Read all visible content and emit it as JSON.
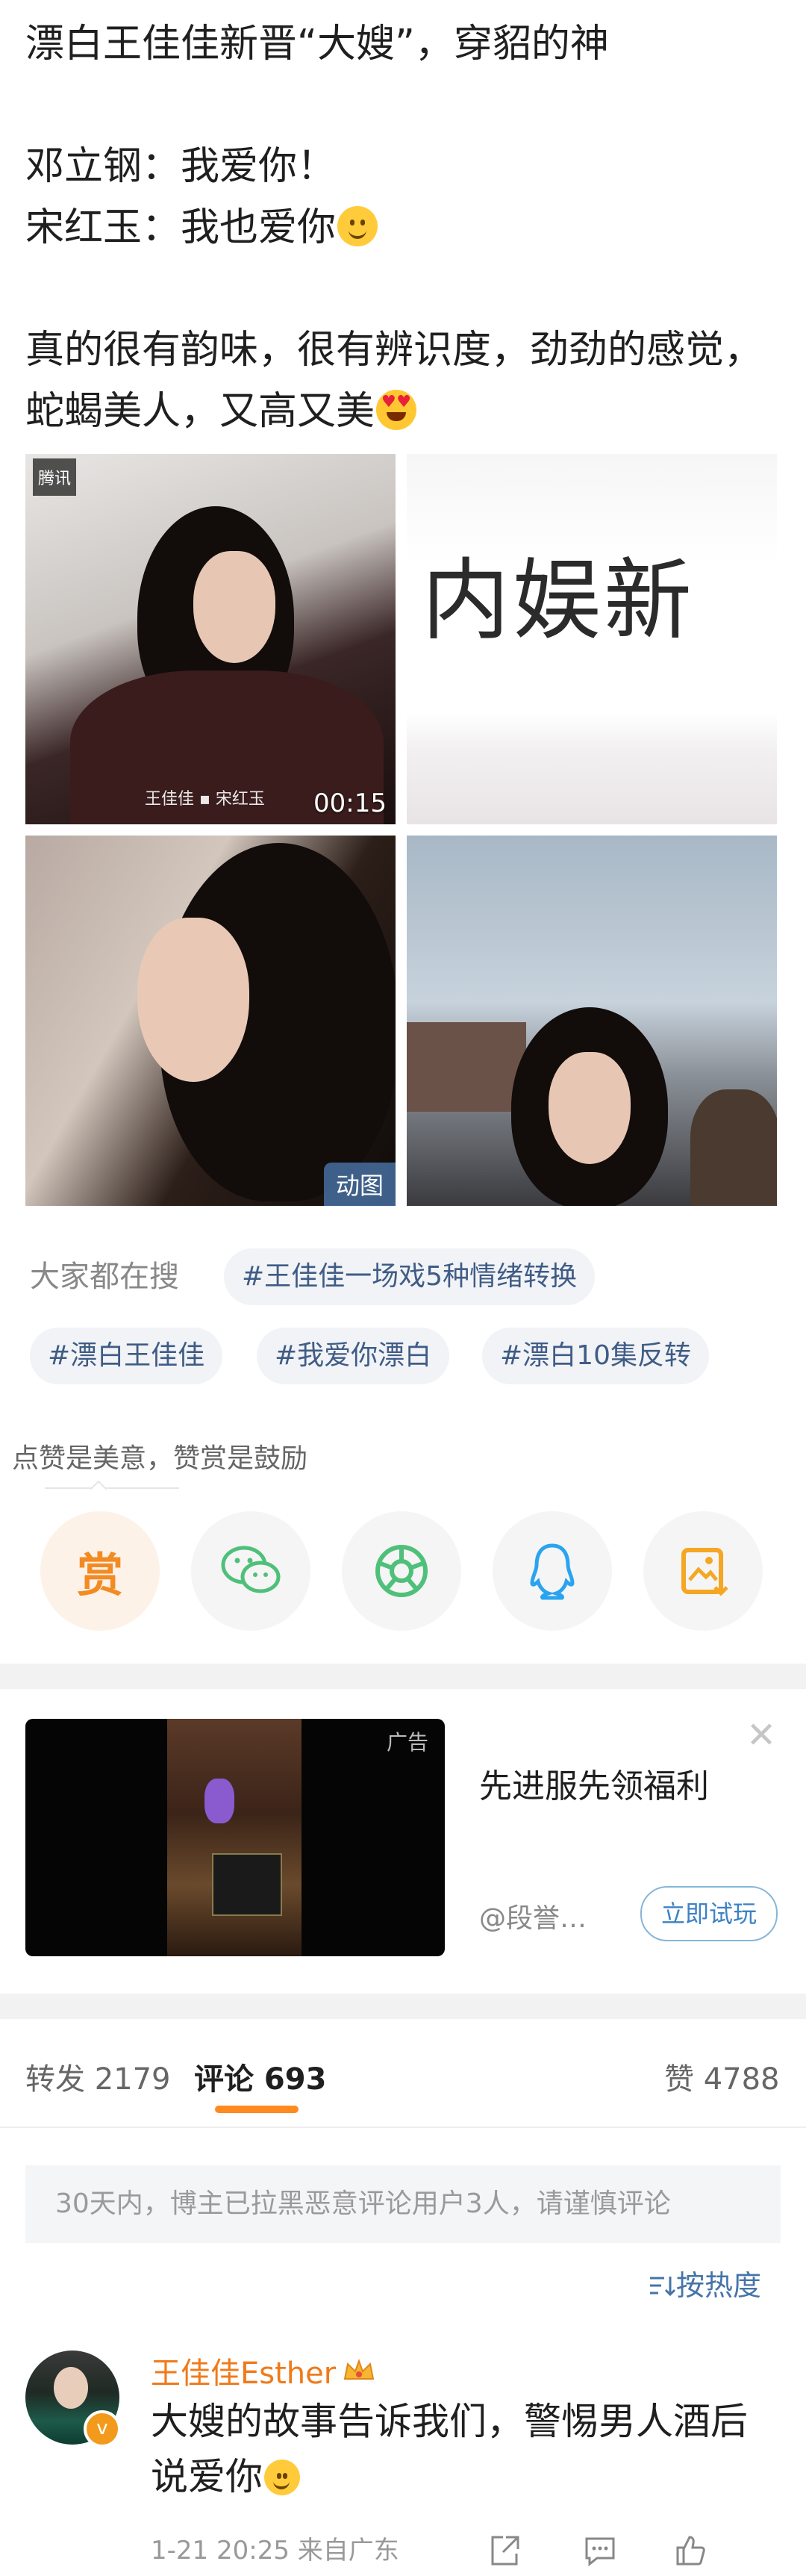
{
  "post": {
    "line1": "漂白王佳佳新晋“大嫂”，穿貂的神",
    "line2": "邓立钢：我爱你！",
    "line3": "宋红玉：我也爱你",
    "line4": "真的很有韵味，很有辨识度，劲劲的感觉，蛇蝎美人，又高又美"
  },
  "media": {
    "video_duration": "00:15",
    "video_caption": "王佳佳 ▪ 宋红玉",
    "video_logo": "腾讯",
    "banner_text": "内娱新",
    "gif_badge": "动图"
  },
  "search": {
    "label": "大家都在搜",
    "chips": [
      "#王佳佳一场戏5种情绪转换",
      "#漂白王佳佳",
      "#我爱你漂白",
      "#漂白10集反转"
    ]
  },
  "tip": {
    "text": "点赞是美意，赞赏是鼓励",
    "reward_label": "赏"
  },
  "ad": {
    "label": "广告",
    "title": "先进服先领福利",
    "handle": "@段誉…",
    "cta": "立即试玩"
  },
  "tabs": {
    "repost": "转发 2179",
    "comment": "评论 693",
    "like": "赞 4788"
  },
  "notice": "30天内，博主已拉黑恶意评论用户3人，请谨慎评论",
  "sort": "按热度",
  "comment": {
    "user": "王佳佳Esther",
    "text": "大嫂的故事告诉我们，警惕男人酒后说爱你",
    "meta": "1-21 20:25  来自广东"
  },
  "colors": {
    "accent": "#ff8a1f",
    "link": "#3f5c85",
    "username": "#f07a1a"
  }
}
